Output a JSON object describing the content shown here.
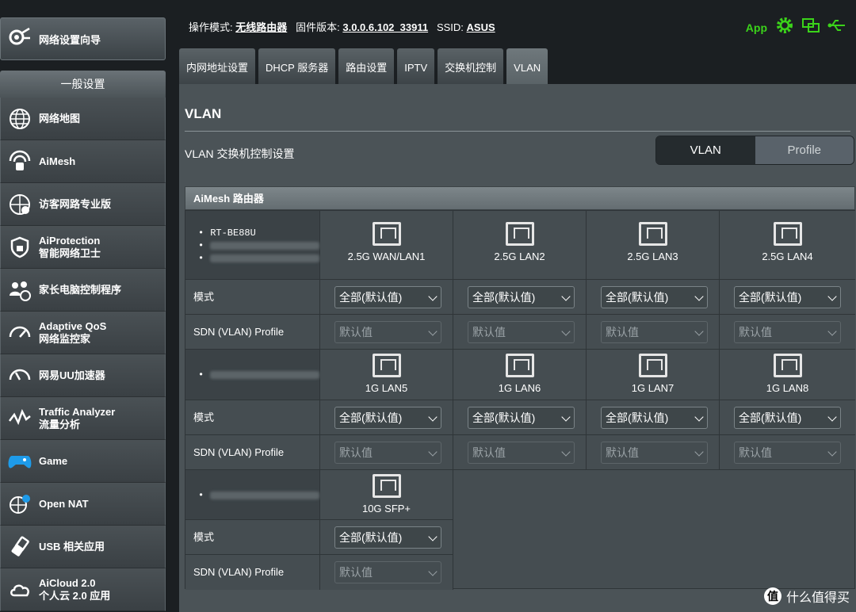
{
  "sidebar": {
    "wizard": "网络设置向导",
    "header": "一般设置",
    "items": [
      {
        "line1": "网络地图",
        "line2": "",
        "icon": "globe-icon"
      },
      {
        "line1": "AiMesh",
        "line2": "",
        "icon": "aimesh-icon"
      },
      {
        "line1": "访客网路专业版",
        "line2": "",
        "icon": "guest-network-icon"
      },
      {
        "line1": "AiProtection",
        "line2": "智能网络卫士",
        "icon": "shield-icon"
      },
      {
        "line1": "家长电脑控制程序",
        "line2": "",
        "icon": "parental-icon"
      },
      {
        "line1": "Adaptive QoS",
        "line2": "网络监控家",
        "icon": "gauge-icon"
      },
      {
        "line1": "网易UU加速器",
        "line2": "",
        "icon": "speed-icon"
      },
      {
        "line1": "Traffic Analyzer",
        "line2": "流量分析",
        "icon": "traffic-icon"
      },
      {
        "line1": "Game",
        "line2": "",
        "icon": "gamepad-icon"
      },
      {
        "line1": "Open NAT",
        "line2": "",
        "icon": "open-nat-icon"
      },
      {
        "line1": "USB 相关应用",
        "line2": "",
        "icon": "usb-icon"
      },
      {
        "line1": "AiCloud 2.0",
        "line2": "个人云 2.0 应用",
        "icon": "cloud-icon"
      }
    ]
  },
  "topbar": {
    "mode_label": "操作模式:",
    "mode_value": "无线路由器",
    "fw_label": "固件版本:",
    "fw_value": "3.0.0.6.102_33911",
    "ssid_label": "SSID:",
    "ssid_value": "ASUS",
    "app_label": "App"
  },
  "tabs": [
    "内网地址设置",
    "DHCP 服务器",
    "路由设置",
    "IPTV",
    "交换机控制",
    "VLAN"
  ],
  "active_tab": "VLAN",
  "page": {
    "title": "VLAN",
    "subtitle": "VLAN 交换机控制设置",
    "seg_vlan": "VLAN",
    "seg_profile": "Profile"
  },
  "table": {
    "header": "AiMesh 路由器",
    "device_name": "RT-BE88U",
    "mode_label": "模式",
    "profile_label": "SDN (VLAN) Profile",
    "mode_value": "全部(默认值)",
    "profile_value": "默认值",
    "ports_row1": [
      "2.5G WAN/LAN1",
      "2.5G LAN2",
      "2.5G LAN3",
      "2.5G LAN4"
    ],
    "ports_row2": [
      "1G LAN5",
      "1G LAN6",
      "1G LAN7",
      "1G LAN8"
    ],
    "ports_row3": [
      "10G SFP+"
    ]
  },
  "watermark": "什么值得买",
  "colors": {
    "accent_green": "#3bd31a",
    "panel": "#4b5357",
    "sidebar": "#3a4044"
  }
}
